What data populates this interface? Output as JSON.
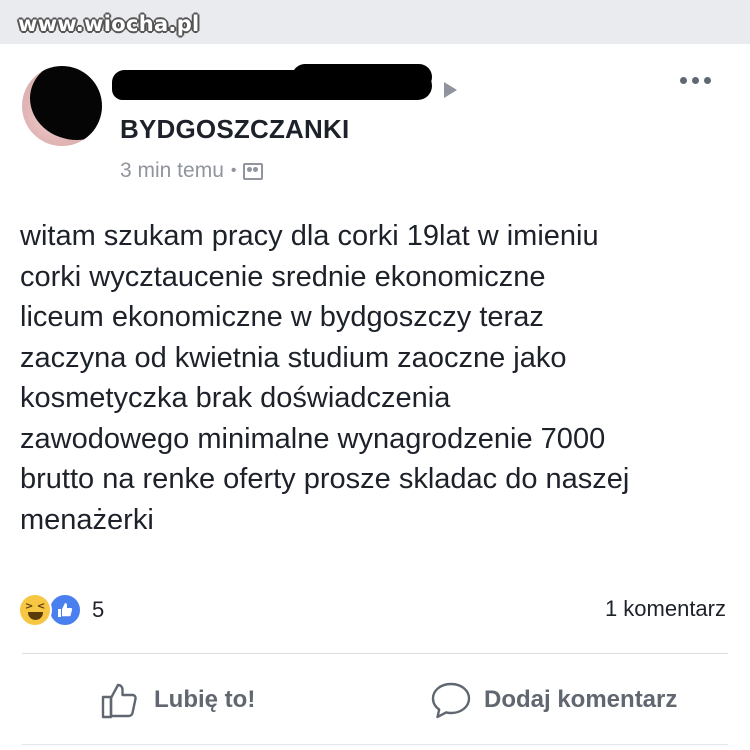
{
  "watermark": "www.wiocha.pl",
  "post": {
    "group_name": "BYDGOSZCZANKI",
    "time": "3 min temu",
    "separator": "•",
    "audience_icon": "group-icon",
    "lines": [
      "witam szukam pracy dla corki 19lat w imieniu",
      "corki wycztaucenie srednie ekonomiczne",
      "liceum ekonomiczne w bydgoszczy teraz",
      "zaczyna od kwietnia studium zaoczne jako",
      "kosmetyczka brak doświadczenia",
      "zawodowego minimalne wynagrodzenie 7000",
      "brutto na renke oferty prosze skladac do naszej",
      "menażerki"
    ]
  },
  "reactions": {
    "icons": [
      "haha-icon",
      "like-icon"
    ],
    "count": "5",
    "comments": "1 komentarz"
  },
  "actions": {
    "like_label": "Lubię to!",
    "comment_label": "Dodaj komentarz"
  },
  "colors": {
    "text": "#1d2129",
    "secondary": "#90949c",
    "action": "#606770",
    "like_blue": "#4a7ff0",
    "haha_yellow": "#f7c744"
  }
}
